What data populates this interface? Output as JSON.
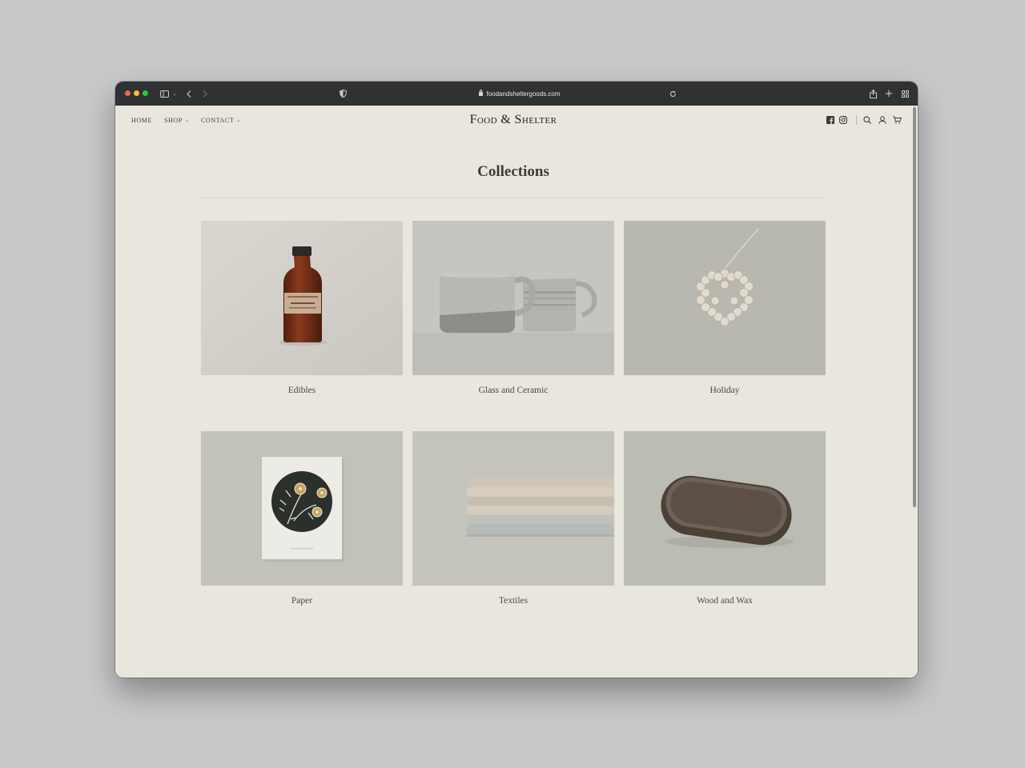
{
  "browser": {
    "url": "foodandsheltergoods.com"
  },
  "site": {
    "logo": "Food & Shelter",
    "nav": [
      {
        "label": "HOME",
        "dropdown": false
      },
      {
        "label": "SHOP",
        "dropdown": true
      },
      {
        "label": "CONTACT",
        "dropdown": true
      }
    ],
    "header_icons": [
      "facebook-icon",
      "instagram-icon",
      "search-icon",
      "account-icon",
      "cart-icon"
    ]
  },
  "page": {
    "title": "Collections",
    "collections": [
      {
        "label": "Edibles",
        "image": "maple-syrup-bottle"
      },
      {
        "label": "Glass and Ceramic",
        "image": "ceramic-mugs"
      },
      {
        "label": "Holiday",
        "image": "wood-bead-star-ornament"
      },
      {
        "label": "Paper",
        "image": "floral-print-card"
      },
      {
        "label": "Textiles",
        "image": "folded-linen-stack"
      },
      {
        "label": "Wood and Wax",
        "image": "walnut-tray"
      }
    ]
  },
  "colors": {
    "background": "#e9e6dd",
    "titlebar": "#2f3133",
    "text": "#3b3b37",
    "outer": "#c8c9cb"
  }
}
